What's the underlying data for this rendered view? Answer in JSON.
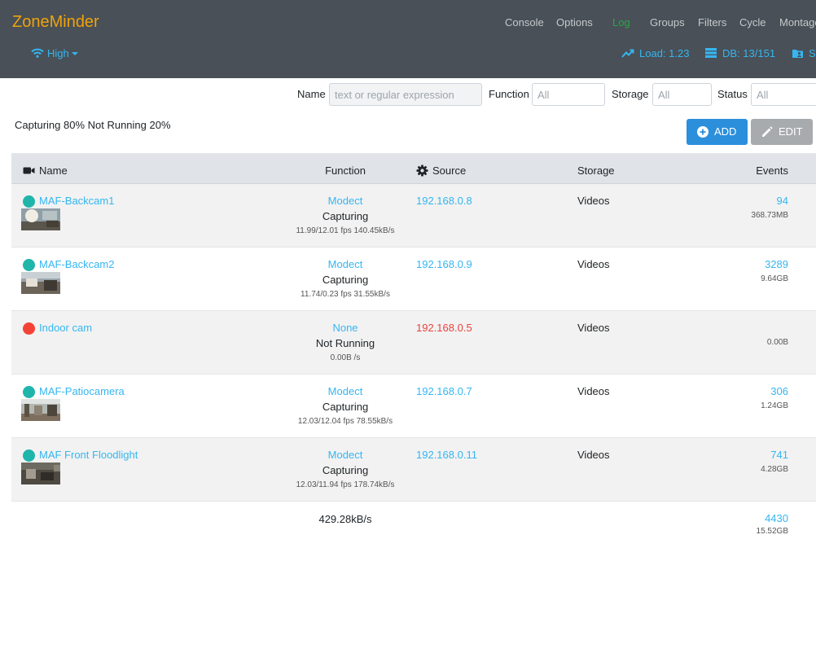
{
  "app": {
    "brand": "ZoneMinder",
    "nav": [
      "Console",
      "Options",
      "Log",
      "Groups",
      "Filters",
      "Cycle",
      "Montage"
    ],
    "active_nav": "Log",
    "bandwidth": "High",
    "load": "Load: 1.23",
    "db": "DB: 13/151",
    "storage_short": "S"
  },
  "filters": {
    "name_label": "Name",
    "name_placeholder": "text or regular expression",
    "function_label": "Function",
    "function_placeholder": "All",
    "storage_label": "Storage",
    "storage_placeholder": "All",
    "status_label": "Status",
    "status_placeholder": "All"
  },
  "summary": "Capturing 80% Not Running 20%",
  "buttons": {
    "add": "ADD",
    "edit": "EDIT"
  },
  "colors": {
    "ok": "#1fb5ab",
    "error": "#f44336",
    "link": "#35b6f0",
    "header": "#495057",
    "brand": "#f0a30a"
  },
  "table": {
    "headers": {
      "name": "Name",
      "function": "Function",
      "source": "Source",
      "storage": "Storage",
      "events": "Events"
    },
    "rows": [
      {
        "name": "MAF-Backcam1",
        "function": "Modect",
        "status": "Capturing",
        "fps": "11.99/12.01 fps 140.45kB/s",
        "source": "192.168.0.8",
        "storage": "Videos",
        "events": "94",
        "size": "368.73MB"
      },
      {
        "name": "MAF-Backcam2",
        "function": "Modect",
        "status": "Capturing",
        "fps": "11.74/0.23 fps 31.55kB/s",
        "source": "192.168.0.9",
        "storage": "Videos",
        "events": "3289",
        "size": "9.64GB"
      },
      {
        "name": "Indoor cam",
        "function": "None",
        "status": "Not Running",
        "fps": "0.00B /s",
        "source": "192.168.0.5",
        "storage": "Videos",
        "events": "",
        "size": "0.00B"
      },
      {
        "name": "MAF-Patiocamera",
        "function": "Modect",
        "status": "Capturing",
        "fps": "12.03/12.04 fps 78.55kB/s",
        "source": "192.168.0.7",
        "storage": "Videos",
        "events": "306",
        "size": "1.24GB"
      },
      {
        "name": "MAF Front Floodlight",
        "function": "Modect",
        "status": "Capturing",
        "fps": "12.03/11.94 fps 178.74kB/s",
        "source": "192.168.0.11",
        "storage": "Videos",
        "events": "741",
        "size": "4.28GB"
      }
    ],
    "totals": {
      "bandwidth": "429.28kB/s",
      "events": "4430",
      "size": "15.52GB"
    }
  }
}
